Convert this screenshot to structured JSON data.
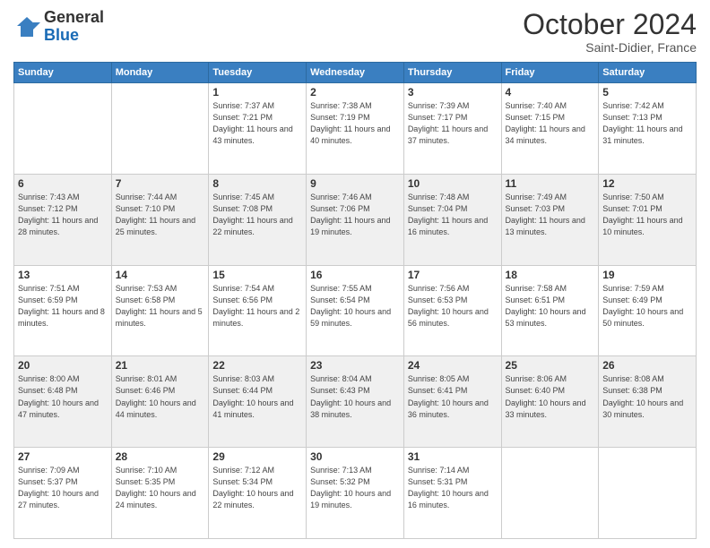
{
  "logo": {
    "general": "General",
    "blue": "Blue"
  },
  "header": {
    "month": "October 2024",
    "location": "Saint-Didier, France"
  },
  "weekdays": [
    "Sunday",
    "Monday",
    "Tuesday",
    "Wednesday",
    "Thursday",
    "Friday",
    "Saturday"
  ],
  "weeks": [
    [
      {
        "day": "",
        "info": ""
      },
      {
        "day": "",
        "info": ""
      },
      {
        "day": "1",
        "info": "Sunrise: 7:37 AM\nSunset: 7:21 PM\nDaylight: 11 hours and 43 minutes."
      },
      {
        "day": "2",
        "info": "Sunrise: 7:38 AM\nSunset: 7:19 PM\nDaylight: 11 hours and 40 minutes."
      },
      {
        "day": "3",
        "info": "Sunrise: 7:39 AM\nSunset: 7:17 PM\nDaylight: 11 hours and 37 minutes."
      },
      {
        "day": "4",
        "info": "Sunrise: 7:40 AM\nSunset: 7:15 PM\nDaylight: 11 hours and 34 minutes."
      },
      {
        "day": "5",
        "info": "Sunrise: 7:42 AM\nSunset: 7:13 PM\nDaylight: 11 hours and 31 minutes."
      }
    ],
    [
      {
        "day": "6",
        "info": "Sunrise: 7:43 AM\nSunset: 7:12 PM\nDaylight: 11 hours and 28 minutes."
      },
      {
        "day": "7",
        "info": "Sunrise: 7:44 AM\nSunset: 7:10 PM\nDaylight: 11 hours and 25 minutes."
      },
      {
        "day": "8",
        "info": "Sunrise: 7:45 AM\nSunset: 7:08 PM\nDaylight: 11 hours and 22 minutes."
      },
      {
        "day": "9",
        "info": "Sunrise: 7:46 AM\nSunset: 7:06 PM\nDaylight: 11 hours and 19 minutes."
      },
      {
        "day": "10",
        "info": "Sunrise: 7:48 AM\nSunset: 7:04 PM\nDaylight: 11 hours and 16 minutes."
      },
      {
        "day": "11",
        "info": "Sunrise: 7:49 AM\nSunset: 7:03 PM\nDaylight: 11 hours and 13 minutes."
      },
      {
        "day": "12",
        "info": "Sunrise: 7:50 AM\nSunset: 7:01 PM\nDaylight: 11 hours and 10 minutes."
      }
    ],
    [
      {
        "day": "13",
        "info": "Sunrise: 7:51 AM\nSunset: 6:59 PM\nDaylight: 11 hours and 8 minutes."
      },
      {
        "day": "14",
        "info": "Sunrise: 7:53 AM\nSunset: 6:58 PM\nDaylight: 11 hours and 5 minutes."
      },
      {
        "day": "15",
        "info": "Sunrise: 7:54 AM\nSunset: 6:56 PM\nDaylight: 11 hours and 2 minutes."
      },
      {
        "day": "16",
        "info": "Sunrise: 7:55 AM\nSunset: 6:54 PM\nDaylight: 10 hours and 59 minutes."
      },
      {
        "day": "17",
        "info": "Sunrise: 7:56 AM\nSunset: 6:53 PM\nDaylight: 10 hours and 56 minutes."
      },
      {
        "day": "18",
        "info": "Sunrise: 7:58 AM\nSunset: 6:51 PM\nDaylight: 10 hours and 53 minutes."
      },
      {
        "day": "19",
        "info": "Sunrise: 7:59 AM\nSunset: 6:49 PM\nDaylight: 10 hours and 50 minutes."
      }
    ],
    [
      {
        "day": "20",
        "info": "Sunrise: 8:00 AM\nSunset: 6:48 PM\nDaylight: 10 hours and 47 minutes."
      },
      {
        "day": "21",
        "info": "Sunrise: 8:01 AM\nSunset: 6:46 PM\nDaylight: 10 hours and 44 minutes."
      },
      {
        "day": "22",
        "info": "Sunrise: 8:03 AM\nSunset: 6:44 PM\nDaylight: 10 hours and 41 minutes."
      },
      {
        "day": "23",
        "info": "Sunrise: 8:04 AM\nSunset: 6:43 PM\nDaylight: 10 hours and 38 minutes."
      },
      {
        "day": "24",
        "info": "Sunrise: 8:05 AM\nSunset: 6:41 PM\nDaylight: 10 hours and 36 minutes."
      },
      {
        "day": "25",
        "info": "Sunrise: 8:06 AM\nSunset: 6:40 PM\nDaylight: 10 hours and 33 minutes."
      },
      {
        "day": "26",
        "info": "Sunrise: 8:08 AM\nSunset: 6:38 PM\nDaylight: 10 hours and 30 minutes."
      }
    ],
    [
      {
        "day": "27",
        "info": "Sunrise: 7:09 AM\nSunset: 5:37 PM\nDaylight: 10 hours and 27 minutes."
      },
      {
        "day": "28",
        "info": "Sunrise: 7:10 AM\nSunset: 5:35 PM\nDaylight: 10 hours and 24 minutes."
      },
      {
        "day": "29",
        "info": "Sunrise: 7:12 AM\nSunset: 5:34 PM\nDaylight: 10 hours and 22 minutes."
      },
      {
        "day": "30",
        "info": "Sunrise: 7:13 AM\nSunset: 5:32 PM\nDaylight: 10 hours and 19 minutes."
      },
      {
        "day": "31",
        "info": "Sunrise: 7:14 AM\nSunset: 5:31 PM\nDaylight: 10 hours and 16 minutes."
      },
      {
        "day": "",
        "info": ""
      },
      {
        "day": "",
        "info": ""
      }
    ]
  ]
}
